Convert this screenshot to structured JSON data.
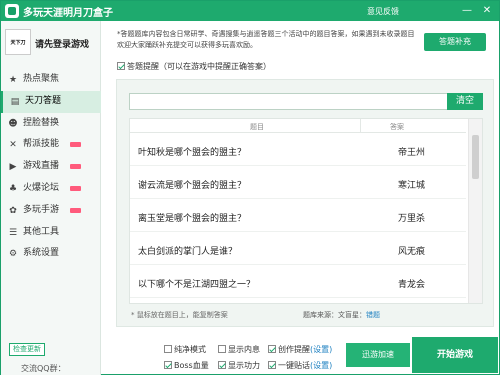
{
  "app": {
    "title": "多玩天涯明月刀盒子",
    "feedback": "意见反馈",
    "minimize": "—",
    "close": "✕"
  },
  "sidebar": {
    "avatar_text": "天下刀",
    "login_text": "请先登录游戏",
    "items": [
      {
        "label": "热点聚焦",
        "icon": "★"
      },
      {
        "label": "天刀答题",
        "icon": "▤"
      },
      {
        "label": "捏脸替换",
        "icon": "☻"
      },
      {
        "label": "帮派技能",
        "icon": "✕"
      },
      {
        "label": "游戏直播",
        "icon": "▶"
      },
      {
        "label": "火爆论坛",
        "icon": "♣"
      },
      {
        "label": "多玩手游",
        "icon": "✿"
      },
      {
        "label": "其他工具",
        "icon": "☰"
      },
      {
        "label": "系统设置",
        "icon": "⚙"
      }
    ],
    "check_update": "检查更新",
    "qq_group": "交流QQ群：93011770"
  },
  "main": {
    "notice": "*答题题库内容包含日常研学、奇遇搜集与逍遥答题三个活动中的题目答案，如果遇到未收录题目欢迎大家踊跃补充提交可以获得多玩喜欢励。",
    "supplement_button": "答题补充",
    "remind_label": "答题提醒（可以在游戏中提醒正确答案）",
    "search_placeholder": "",
    "clear_button": "清空",
    "table": {
      "col_question": "题目",
      "col_answer": "答案",
      "rows": [
        {
          "q": "叶知秋是哪个盟会的盟主？",
          "a": "帝王州"
        },
        {
          "q": "谢云流是哪个盟会的盟主？",
          "a": "寒江城"
        },
        {
          "q": "离玉堂是哪个盟会的盟主？",
          "a": "万里杀"
        },
        {
          "q": "太白剑派的掌门人是谁？",
          "a": "风无痕"
        },
        {
          "q": "以下哪个不是江湖四盟之一？",
          "a": "青龙会"
        }
      ]
    },
    "hint": "* 鼠标放在题目上，能复制答案",
    "source_prefix": "题库来源：文盲星：",
    "source_link": "错题"
  },
  "bottom": {
    "options": [
      {
        "label": "纯净模式",
        "checked": false
      },
      {
        "label": "显示内息",
        "checked": false
      },
      {
        "label": "创作提醒",
        "checked": true,
        "extra": "(设置)"
      },
      {
        "label": "Boss血量",
        "checked": true
      },
      {
        "label": "显示功力",
        "checked": true
      },
      {
        "label": "一键贴话",
        "checked": true,
        "extra": "(设置)"
      }
    ],
    "accelerate_button": "迅游加速",
    "start_button": "开始游戏"
  },
  "colors": {
    "accent": "#1eaa6e",
    "link": "#1b7fc0",
    "badge": "#ff5b7c"
  }
}
